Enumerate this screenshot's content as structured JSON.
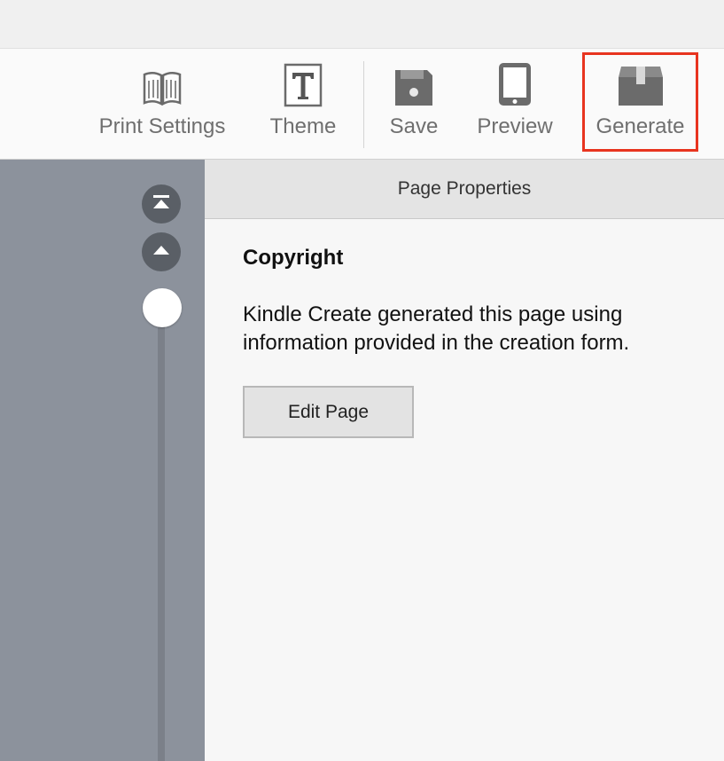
{
  "toolbar": {
    "items": [
      {
        "label": "Print Settings",
        "icon": "book-icon"
      },
      {
        "label": "Theme",
        "icon": "theme-t-icon"
      },
      {
        "label": "Save",
        "icon": "save-icon"
      },
      {
        "label": "Preview",
        "icon": "tablet-icon"
      },
      {
        "label": "Generate",
        "icon": "box-icon"
      }
    ],
    "highlight_color": "#e8341f"
  },
  "sidebar": {
    "buttons": [
      {
        "icon": "jump-to-top-icon"
      },
      {
        "icon": "page-up-icon"
      }
    ]
  },
  "panel": {
    "header": "Page Properties",
    "section_title": "Copyright",
    "description": "Kindle Create generated this page using information provided in the creation form.",
    "edit_button": "Edit Page"
  }
}
